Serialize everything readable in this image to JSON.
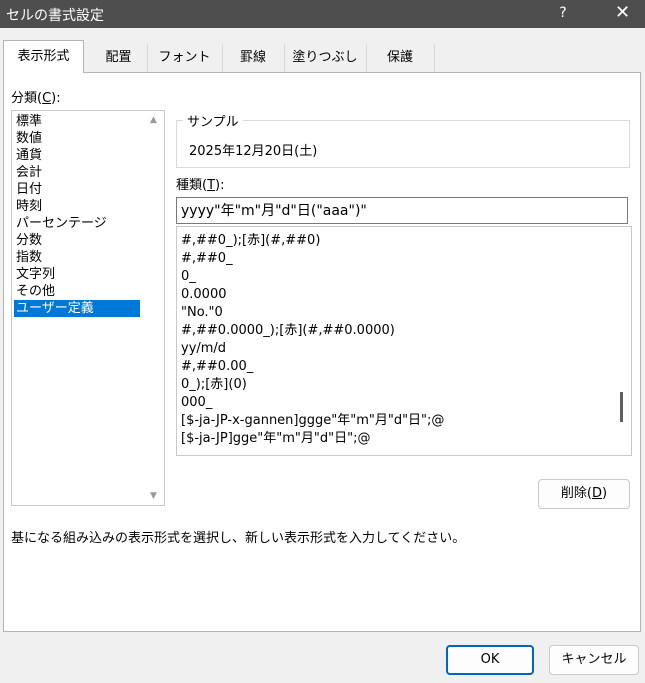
{
  "window": {
    "title": "セルの書式設定",
    "help": "?",
    "close": "✕"
  },
  "tabs": [
    {
      "label": "表示形式"
    },
    {
      "label": "配置"
    },
    {
      "label": "フォント"
    },
    {
      "label": "罫線"
    },
    {
      "label": "塗りつぶし"
    },
    {
      "label": "保護"
    }
  ],
  "category": {
    "label_prefix": "分類(",
    "label_key": "C",
    "label_suffix": "):",
    "items": [
      "標準",
      "数値",
      "通貨",
      "会計",
      "日付",
      "時刻",
      "パーセンテージ",
      "分数",
      "指数",
      "文字列",
      "その他",
      "ユーザー定義"
    ],
    "selected": "ユーザー定義"
  },
  "sample": {
    "label": "サンプル",
    "value": "2025年12月20日(土)"
  },
  "type": {
    "label_prefix": "種類(",
    "label_key": "T",
    "label_suffix": "):",
    "value": "yyyy\"年\"m\"月\"d\"日(\"aaa\")\"",
    "formats": [
      "#,##0_);[赤](#,##0)",
      "#,##0_",
      "0_",
      "0.0000",
      "\"No.\"0",
      "#,##0.0000_);[赤](#,##0.0000)",
      "yy/m/d",
      "#,##0.00_",
      "0_);[赤](0)",
      "000_",
      "[$-ja-JP-x-gannen]ggge\"年\"m\"月\"d\"日\";@",
      "[$-ja-JP]gge\"年\"m\"月\"d\"日\";@"
    ]
  },
  "delete_button": {
    "prefix": "削除(",
    "key": "D",
    "suffix": ")"
  },
  "hint": "基になる組み込みの表示形式を選択し、新しい表示形式を入力してください。",
  "footer": {
    "ok": "OK",
    "cancel": "キャンセル"
  }
}
